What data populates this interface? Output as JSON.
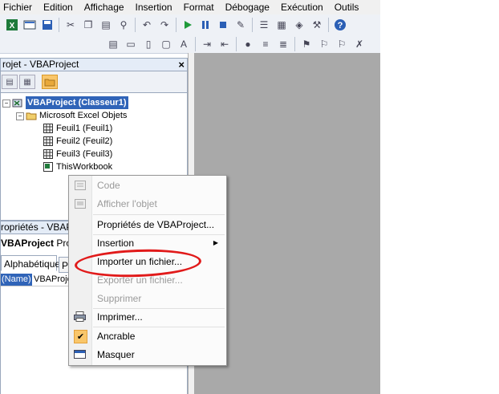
{
  "menubar": {
    "items": [
      "Fichier",
      "Edition",
      "Affichage",
      "Insertion",
      "Format",
      "Débogage",
      "Exécution",
      "Outils"
    ]
  },
  "project_panel": {
    "title": "rojet - VBAProject",
    "close_glyph": "×",
    "tree": {
      "root": "VBAProject (Classeur1)",
      "folder": "Microsoft Excel Objets",
      "sheets": [
        "Feuil1 (Feuil1)",
        "Feuil2 (Feuil2)",
        "Feuil3 (Feuil3)"
      ],
      "workbook": "ThisWorkbook"
    }
  },
  "properties_panel": {
    "title": "ropriétés - VBAP",
    "object_label": "VBAProject",
    "object_type": "Proje",
    "tabs": [
      "Alphabétique",
      "Pa"
    ],
    "row_name": "(Name)",
    "row_value": "VBAProje"
  },
  "context_menu": {
    "items": [
      {
        "label": "Code",
        "disabled": true,
        "icon": "code-icon"
      },
      {
        "label": "Afficher l'objet",
        "disabled": true,
        "icon": "view-object-icon"
      },
      {
        "label": "Propriétés de VBAProject...",
        "disabled": false
      },
      {
        "label": "Insertion",
        "disabled": false,
        "submenu": true
      },
      {
        "label": "Importer un fichier...",
        "disabled": false
      },
      {
        "label": "Exporter un fichier...",
        "disabled": true
      },
      {
        "label": "Supprimer",
        "disabled": true
      },
      {
        "label": "Imprimer...",
        "disabled": false,
        "icon": "printer-icon"
      },
      {
        "label": "Ancrable",
        "disabled": false,
        "checked": true
      },
      {
        "label": "Masquer",
        "disabled": false,
        "icon": "hide-window-icon"
      }
    ],
    "submenu_arrow": "▶",
    "check_glyph": "✔"
  },
  "colors": {
    "selection": "#3064b8",
    "highlight_ellipse": "#e11a1a",
    "code_area": "#a9a9a9"
  }
}
